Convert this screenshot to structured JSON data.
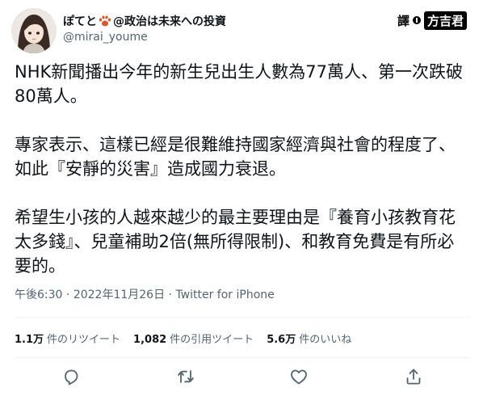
{
  "author": {
    "name_part1": "ぽてと",
    "name_part2": "@政治は未来への投資",
    "handle": "@mirai_youme"
  },
  "badge": {
    "prefix": "譯",
    "translator": "方吉君"
  },
  "tweet": {
    "paragraphs": [
      "NHK新聞播出今年的新生兒出生人數為77萬人、第一次跌破80萬人。",
      "專家表示、這樣已經是很難維持國家經濟與社會的程度了、如此『安靜的災害』造成國力衰退。",
      "希望生小孩的人越來越少的最主要理由是『養育小孩教育花太多錢』、兒童補助2倍(無所得限制)、和教育免費是有所必要的。"
    ],
    "time": "午後6:30",
    "dot": " · ",
    "date": "2022年11月26日",
    "source": "Twitter for iPhone"
  },
  "stats": {
    "retweets_count": "1.1万",
    "retweets_label": "件のリツイート",
    "quotes_count": "1,082",
    "quotes_label": "件の引用ツイート",
    "likes_count": "5.6万",
    "likes_label": "件のいいね"
  },
  "icons": {
    "reply": "reply-icon",
    "retweet": "retweet-icon",
    "like": "heart-icon",
    "share": "share-icon",
    "paw": "paw-icon"
  },
  "colors": {
    "text": "#0f1419",
    "secondary": "#536471",
    "divider": "#eff3f4",
    "paw": "#d9572b"
  }
}
